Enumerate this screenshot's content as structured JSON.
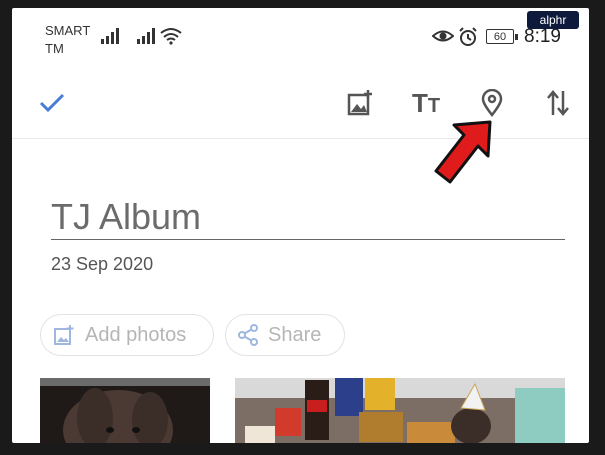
{
  "watermark": {
    "brand": "alphr"
  },
  "status_bar": {
    "carrier_line1": "SMART",
    "carrier_line2": "TM",
    "battery": "60",
    "time": "8:19",
    "icons": [
      "signal-icon",
      "signal-icon",
      "wifi-icon",
      "eye-icon",
      "alarm-icon"
    ]
  },
  "toolbar": {
    "done_icon": "check-icon",
    "add_photo_icon": "add-photo-icon",
    "text_icon_label": "TT",
    "location_icon": "location-pin-icon",
    "sort_icon": "sort-arrows-icon"
  },
  "album": {
    "title": "TJ Album",
    "date": "23 Sep 2020"
  },
  "actions": {
    "add_photos_label": "Add photos",
    "share_label": "Share"
  },
  "colors": {
    "accent": "#4a7dd6",
    "arrow": "#e01b1b"
  }
}
